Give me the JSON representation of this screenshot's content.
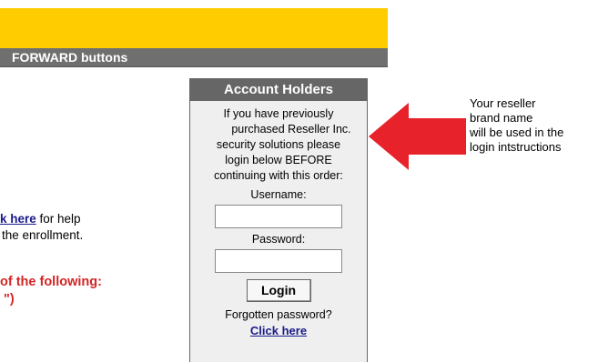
{
  "header": {
    "bar_text": "FORWARD buttons"
  },
  "help": {
    "link_text": "k here",
    "line1_rest": " for help",
    "line2": "the enrollment."
  },
  "notice": {
    "line1": "of the following:",
    "line2": "\")"
  },
  "account": {
    "title": "Account Holders",
    "description": [
      "If you have previously",
      "purchased Reseller Inc.",
      "security solutions please",
      "login below BEFORE",
      "continuing with this order:"
    ],
    "username_label": "Username:",
    "username_value": "",
    "password_label": "Password:",
    "password_value": "",
    "login_button": "Login",
    "forgot_text": "Forgotten password?",
    "click_here": "Click here"
  },
  "callout": {
    "lines": [
      "Your reseller",
      "brand name",
      "will be used in the",
      "login intstructions"
    ]
  },
  "colors": {
    "yellow": "#ffcc00",
    "bar_gray": "#6f6f6f",
    "arrow_red": "#e8222a",
    "notice_red": "#d42424",
    "link_blue": "#1a1a8a"
  }
}
